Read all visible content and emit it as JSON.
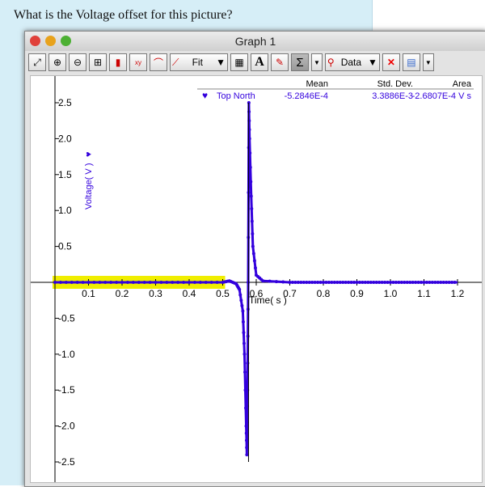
{
  "question": "What is the Voltage offset for this picture?",
  "window": {
    "title": "Graph 1"
  },
  "toolbar": {
    "fit_label": "Fit",
    "data_label": "Data",
    "sigma": "Σ",
    "text_tool": "A"
  },
  "stats": {
    "headers": [
      "Mean",
      "Std. Dev.",
      "Area"
    ],
    "series": "Top North",
    "mean": "-5.2846E-4",
    "std": "3.3886E-3",
    "area": "-2.6807E-4 V s"
  },
  "colors": {
    "series": "#3300dd",
    "selection": "#f0ee00"
  },
  "chart_data": {
    "type": "line",
    "xlabel": "Time( s )",
    "ylabel": "Voltage( V )",
    "xlim": [
      0,
      1.2
    ],
    "ylim": [
      -2.6,
      2.7
    ],
    "xticks": [
      "0.1",
      "0.2",
      "0.3",
      "0.4",
      "0.5",
      "0.6",
      "0.7",
      "0.8",
      "0.9",
      "1.0",
      "1.1",
      "1.2"
    ],
    "yticks": [
      "2.5",
      "2.0",
      "1.5",
      "1.0",
      "0.5",
      "-0.5",
      "-1.0",
      "-1.5",
      "-2.0",
      "-2.5"
    ],
    "selected_range": [
      0,
      0.5
    ],
    "series": [
      {
        "name": "Top North",
        "points": [
          [
            0,
            0
          ],
          [
            0.5,
            0
          ],
          [
            0.52,
            0.02
          ],
          [
            0.54,
            -0.02
          ],
          [
            0.55,
            -0.1
          ],
          [
            0.56,
            -0.4
          ],
          [
            0.565,
            -1.0
          ],
          [
            0.57,
            -2.0
          ],
          [
            0.572,
            -2.4
          ],
          [
            0.574,
            -1.5
          ],
          [
            0.576,
            0
          ],
          [
            0.578,
            2.5
          ],
          [
            0.58,
            2.0
          ],
          [
            0.585,
            1.2
          ],
          [
            0.59,
            0.5
          ],
          [
            0.6,
            0.1
          ],
          [
            0.62,
            0.02
          ],
          [
            0.7,
            0
          ],
          [
            1.2,
            0
          ]
        ]
      }
    ]
  }
}
